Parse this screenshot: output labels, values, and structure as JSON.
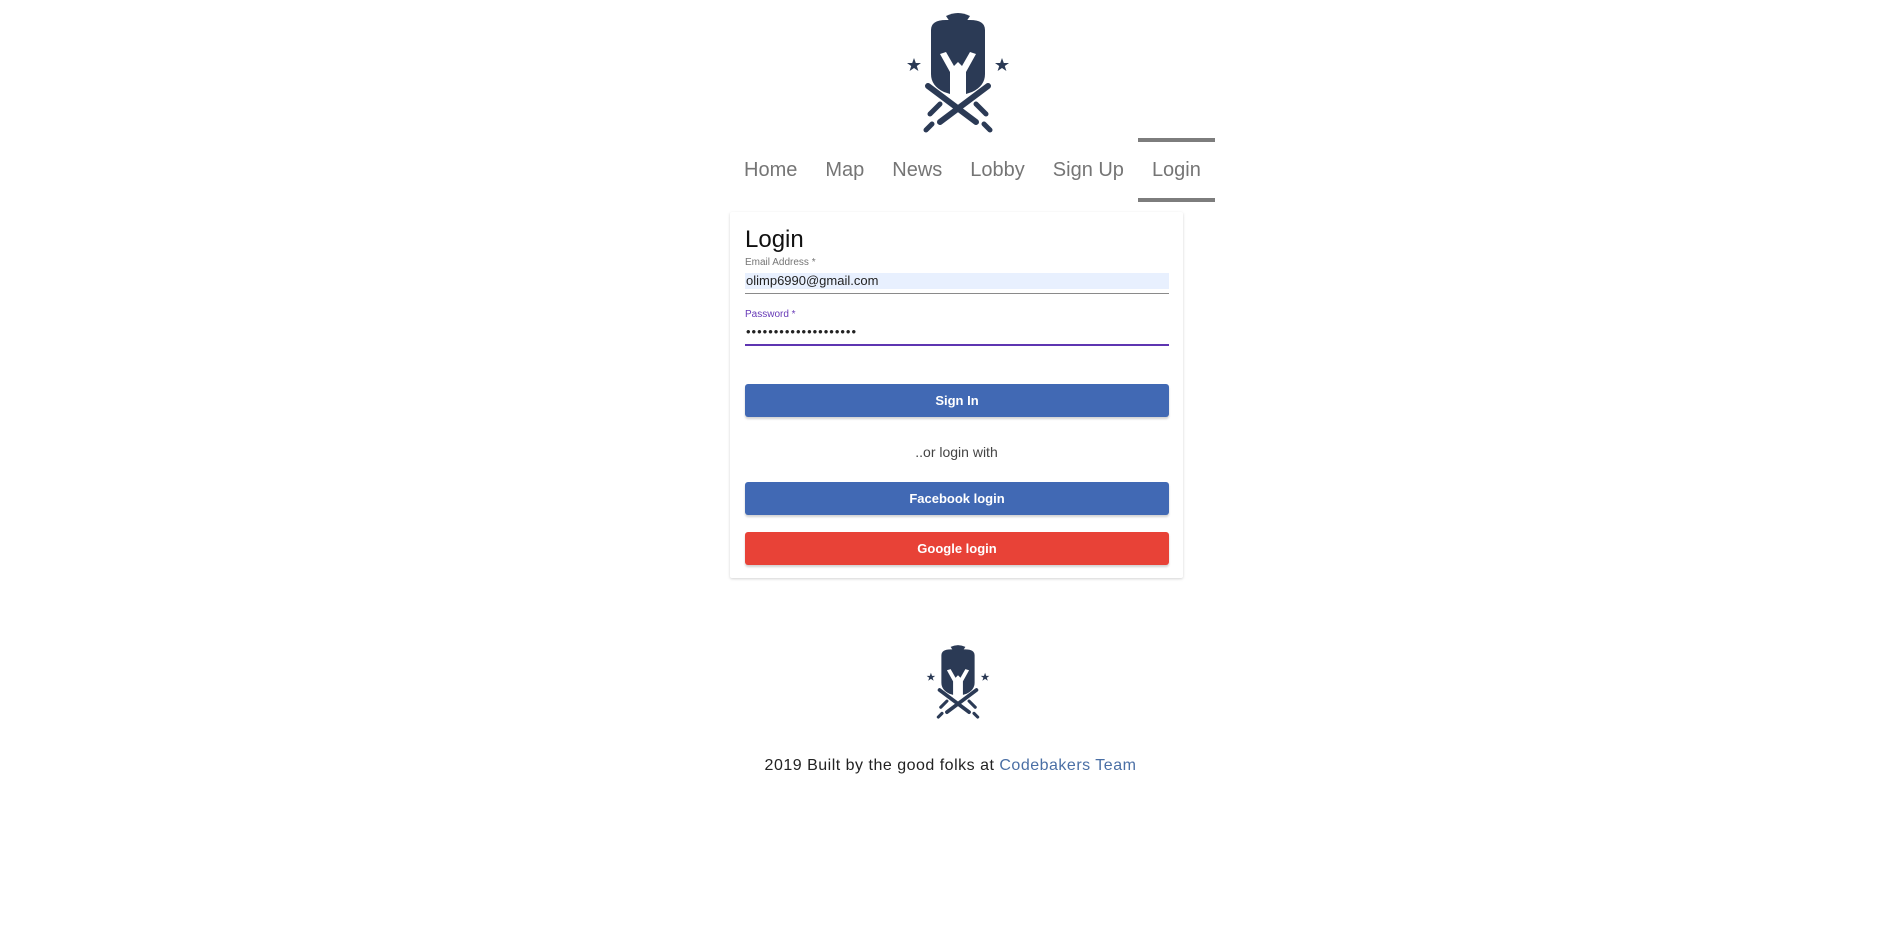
{
  "brand": {
    "logo_icon": "spartan-helmet-crossed-swords-icon",
    "logo_color": "#2b3a55"
  },
  "nav": {
    "items": [
      {
        "label": "Home",
        "active": false
      },
      {
        "label": "Map",
        "active": false
      },
      {
        "label": "News",
        "active": false
      },
      {
        "label": "Lobby",
        "active": false
      },
      {
        "label": "Sign Up",
        "active": false
      },
      {
        "label": "Login",
        "active": true
      }
    ]
  },
  "login": {
    "title": "Login",
    "email_label": "Email Address *",
    "email_value": "olimp6990@gmail.com",
    "password_label": "Password *",
    "password_value": "••••••••••••••••••••",
    "signin_label": "Sign In",
    "or_text": "..or login with",
    "facebook_label": "Facebook login",
    "google_label": "Google login"
  },
  "footer": {
    "text": "2019 Built by the good folks at",
    "link_text": "Codebakers Team"
  },
  "colors": {
    "primary_blue": "#4169b4",
    "google_red": "#e84237",
    "focus_purple": "#5e35b1",
    "autofill_bg": "#e8f0fe",
    "link": "#4a6fa5"
  }
}
